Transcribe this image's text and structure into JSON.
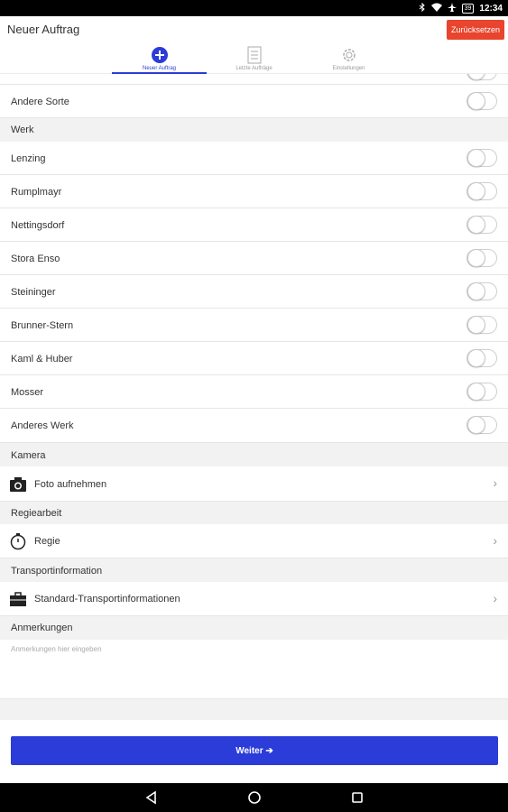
{
  "status_bar": {
    "battery": "39",
    "time": "12:34"
  },
  "header": {
    "title": "Neuer Auftrag",
    "reset_label": "Zurücksetzen"
  },
  "tabs": [
    {
      "label": "Neuer Auftrag",
      "icon": "plus-circle-icon",
      "active": true
    },
    {
      "label": "Letzte Aufträge",
      "icon": "list-icon",
      "active": false
    },
    {
      "label": "Einstellungen",
      "icon": "gear-icon",
      "active": false
    }
  ],
  "rows": {
    "andere_sorte": "Andere Sorte"
  },
  "werk": {
    "title": "Werk",
    "items": [
      {
        "label": "Lenzing",
        "on": false
      },
      {
        "label": "Rumplmayr",
        "on": false
      },
      {
        "label": "Nettingsdorf",
        "on": false
      },
      {
        "label": "Stora Enso",
        "on": false
      },
      {
        "label": "Steininger",
        "on": false
      },
      {
        "label": "Brunner-Stern",
        "on": false
      },
      {
        "label": "Kaml & Huber",
        "on": false
      },
      {
        "label": "Mosser",
        "on": false
      },
      {
        "label": "Anderes Werk",
        "on": false
      }
    ]
  },
  "kamera": {
    "title": "Kamera",
    "item": "Foto aufnehmen"
  },
  "regiearbeit": {
    "title": "Regiearbeit",
    "item": "Regie"
  },
  "transport": {
    "title": "Transportinformation",
    "item": "Standard-Transportinformationen"
  },
  "anmerkungen": {
    "title": "Anmerkungen",
    "placeholder": "Anmerkungen hier eingeben"
  },
  "footer": {
    "next_label": "Weiter ➔"
  },
  "colors": {
    "accent": "#2b3cd8",
    "reset": "#e8442e"
  }
}
